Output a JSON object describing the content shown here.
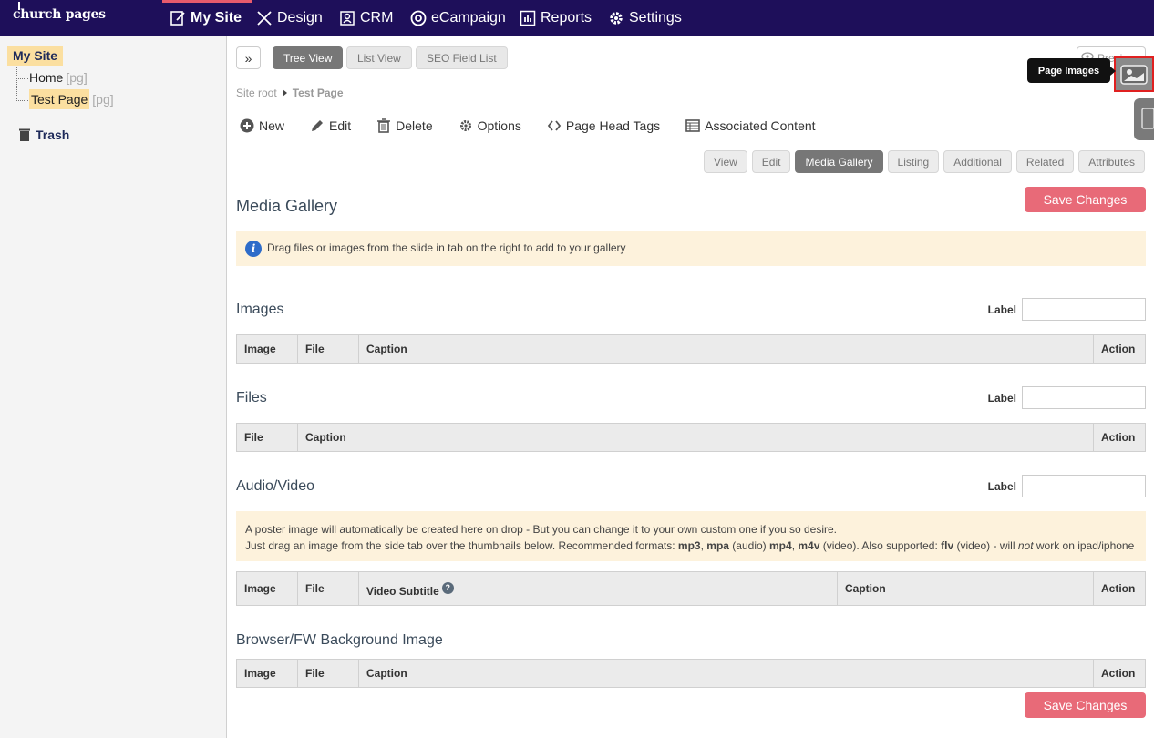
{
  "nav": {
    "brand": "church pages",
    "items": [
      {
        "label": "My Site",
        "icon": "edit-page-icon"
      },
      {
        "label": "Design",
        "icon": "design-tools-icon"
      },
      {
        "label": "CRM",
        "icon": "contacts-icon"
      },
      {
        "label": "eCampaign",
        "icon": "at-sign-icon"
      },
      {
        "label": "Reports",
        "icon": "bar-chart-icon"
      },
      {
        "label": "Settings",
        "icon": "gear-icon"
      }
    ]
  },
  "sidebar": {
    "root": "My Site",
    "nodes": [
      {
        "label": "Home",
        "suffix": "[pg]"
      },
      {
        "label": "Test Page",
        "suffix": "[pg]"
      }
    ],
    "trash": "Trash"
  },
  "toolbar": {
    "views": [
      "Tree View",
      "List View",
      "SEO Field List"
    ],
    "preview": "Preview"
  },
  "breadcrumb": {
    "root": "Site root",
    "current": "Test Page"
  },
  "actions": [
    "New",
    "Edit",
    "Delete",
    "Options",
    "Page Head Tags",
    "Associated Content"
  ],
  "tabs": [
    "View",
    "Edit",
    "Media Gallery",
    "Listing",
    "Additional",
    "Related",
    "Attributes"
  ],
  "page": {
    "title": "Media Gallery",
    "save_label": "Save Changes",
    "notice": "Drag files or images from the slide in tab on the right to add to your gallery"
  },
  "sections": {
    "images": {
      "title": "Images",
      "label": "Label",
      "columns": [
        "Image",
        "File",
        "Caption",
        "Action"
      ]
    },
    "files": {
      "title": "Files",
      "label": "Label",
      "columns": [
        "File",
        "Caption",
        "Action"
      ]
    },
    "av": {
      "title": "Audio/Video",
      "label": "Label",
      "notice_line1": "A poster image will automatically be created here on drop - But you can change it to your own custom one if you so desire.",
      "notice_line2_a": "Just drag an image from the side tab over the thumbnails below. Recommended formats: ",
      "notice_mp3": "mp3",
      "notice_sep1": ", ",
      "notice_mpa": "mpa",
      "notice_audio": " (audio) ",
      "notice_mp4": "mp4",
      "notice_sep2": ", ",
      "notice_m4v": "m4v",
      "notice_video": " (video). Also supported: ",
      "notice_flv": "flv",
      "notice_will": " (video) - will ",
      "notice_not": "not",
      "notice_end": " work on ipad/iphone",
      "columns": [
        "Image",
        "File",
        "Video Subtitle",
        "Caption",
        "Action"
      ]
    },
    "bg": {
      "title": "Browser/FW Background Image",
      "columns": [
        "Image",
        "File",
        "Caption",
        "Action"
      ]
    }
  },
  "tooltip": "Page Images",
  "colors": {
    "nav_bg": "#1e0f5a",
    "accent": "#e85a6c",
    "highlight": "#fbdfa0"
  }
}
